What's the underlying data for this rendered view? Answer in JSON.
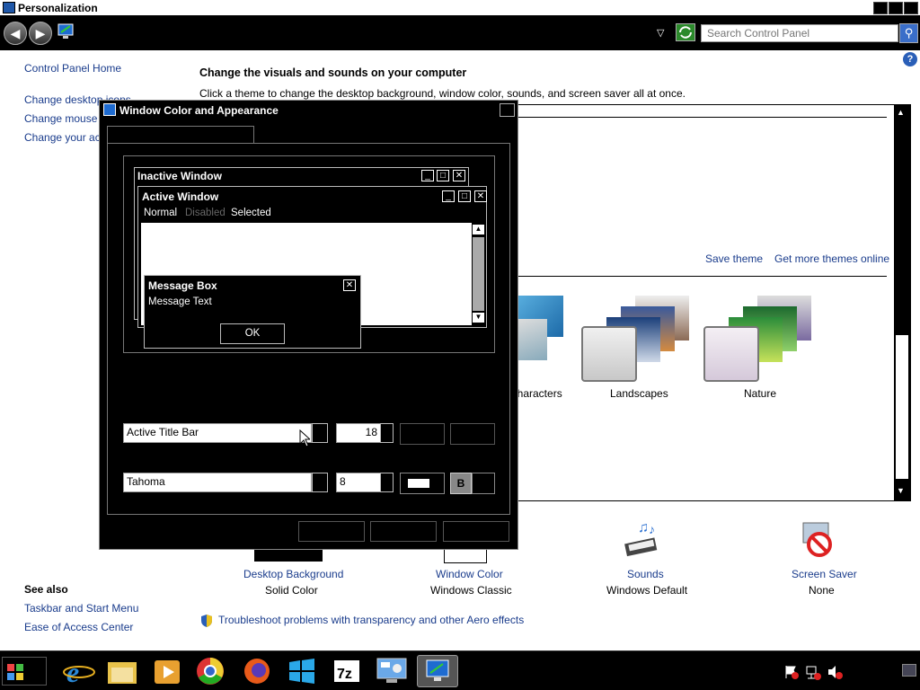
{
  "window": {
    "title": "Personalization"
  },
  "search": {
    "placeholder": "Search Control Panel"
  },
  "left_pane": {
    "home": "Control Panel Home",
    "links": [
      "Change desktop icons",
      "Change mouse pointers",
      "Change your account picture"
    ],
    "see_also_title": "See also",
    "see_also": [
      "Taskbar and Start Menu",
      "Ease of Access Center"
    ]
  },
  "main": {
    "heading": "Change the visuals and sounds on your computer",
    "subheading": "Click a theme to change the desktop background, window color, sounds, and screen saver all at once.",
    "save_theme": "Save theme",
    "get_more_themes": "Get more themes online",
    "themes": [
      "Characters",
      "Landscapes",
      "Nature"
    ],
    "bottom_items": [
      {
        "title": "Desktop Background",
        "value": "Solid Color"
      },
      {
        "title": "Window Color",
        "value": "Windows Classic"
      },
      {
        "title": "Sounds",
        "value": "Windows Default"
      },
      {
        "title": "Screen Saver",
        "value": "None"
      }
    ],
    "troubleshoot": "Troubleshoot problems with transparency and other Aero effects"
  },
  "dialog": {
    "title": "Window Color and Appearance",
    "preview": {
      "inactive": "Inactive Window",
      "active": "Active Window",
      "menu_normal": "Normal",
      "menu_disabled": "Disabled",
      "menu_selected": "Selected",
      "msgbox_title": "Message Box",
      "msgbox_text": "Message Text",
      "ok": "OK"
    },
    "item_select": "Active Title Bar",
    "item_size": "18",
    "font_select": "Tahoma",
    "font_size": "8",
    "bold": "B"
  },
  "taskbar": {
    "apps": [
      "internet-explorer",
      "file-explorer",
      "media-player",
      "chrome",
      "firefox",
      "windows-store",
      "7zip",
      "control-panel",
      "personalization"
    ]
  }
}
